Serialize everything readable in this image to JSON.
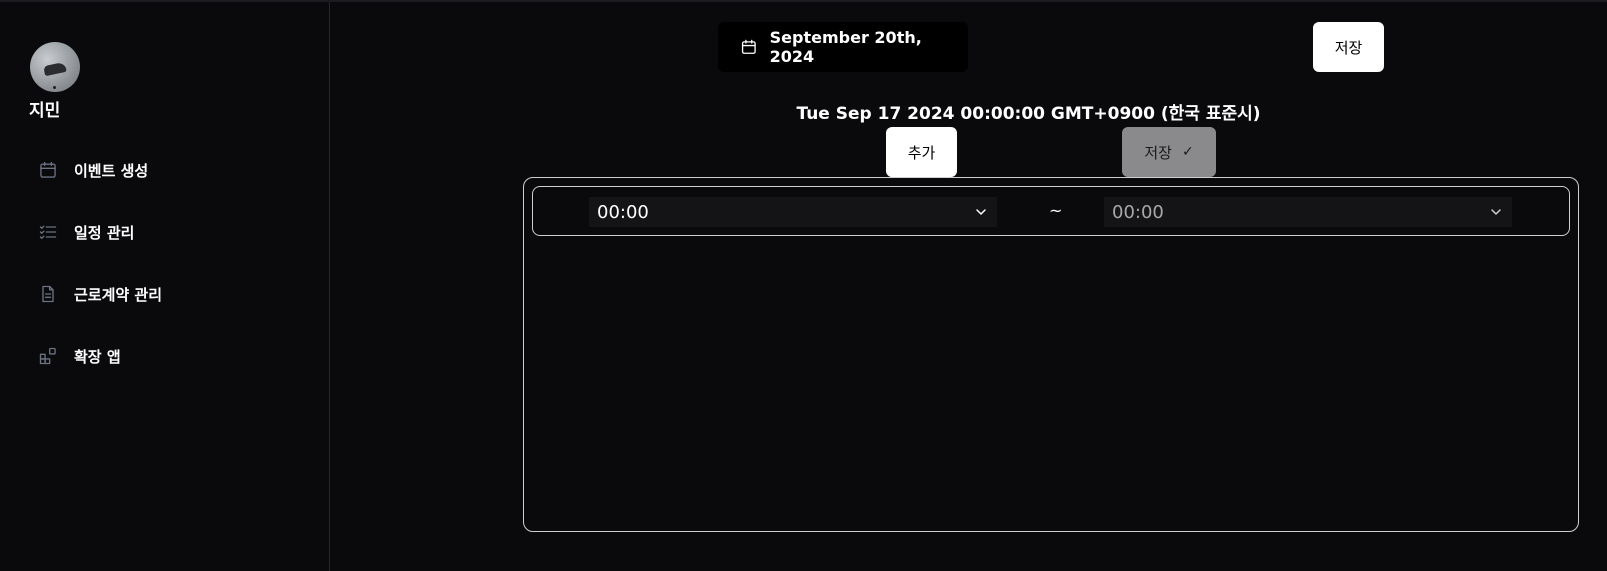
{
  "sidebar": {
    "user_name": "지민",
    "items": [
      {
        "label": "이벤트 생성",
        "icon": "calendar-icon"
      },
      {
        "label": "일정 관리",
        "icon": "checklist-icon"
      },
      {
        "label": "근로계약 관리",
        "icon": "document-icon"
      },
      {
        "label": "확장 앱",
        "icon": "apps-icon"
      }
    ]
  },
  "header": {
    "date_button_label": "September 20th, 2024",
    "save_label": "저장"
  },
  "main": {
    "date_string": "Tue Sep 17 2024 00:00:00 GMT+0900 (한국 표준시)",
    "add_label": "추가",
    "save_confirm_label": "저장",
    "save_confirm_check": "✓",
    "time_rows": [
      {
        "start": "00:00",
        "separator": "~",
        "end": "00:00"
      }
    ]
  },
  "colors": {
    "background": "#0a0a0c",
    "panel_border": "#cfcfd2",
    "button_white": "#ffffff",
    "button_disabled": "#8a8a8d",
    "icon_muted": "#6b7280"
  }
}
